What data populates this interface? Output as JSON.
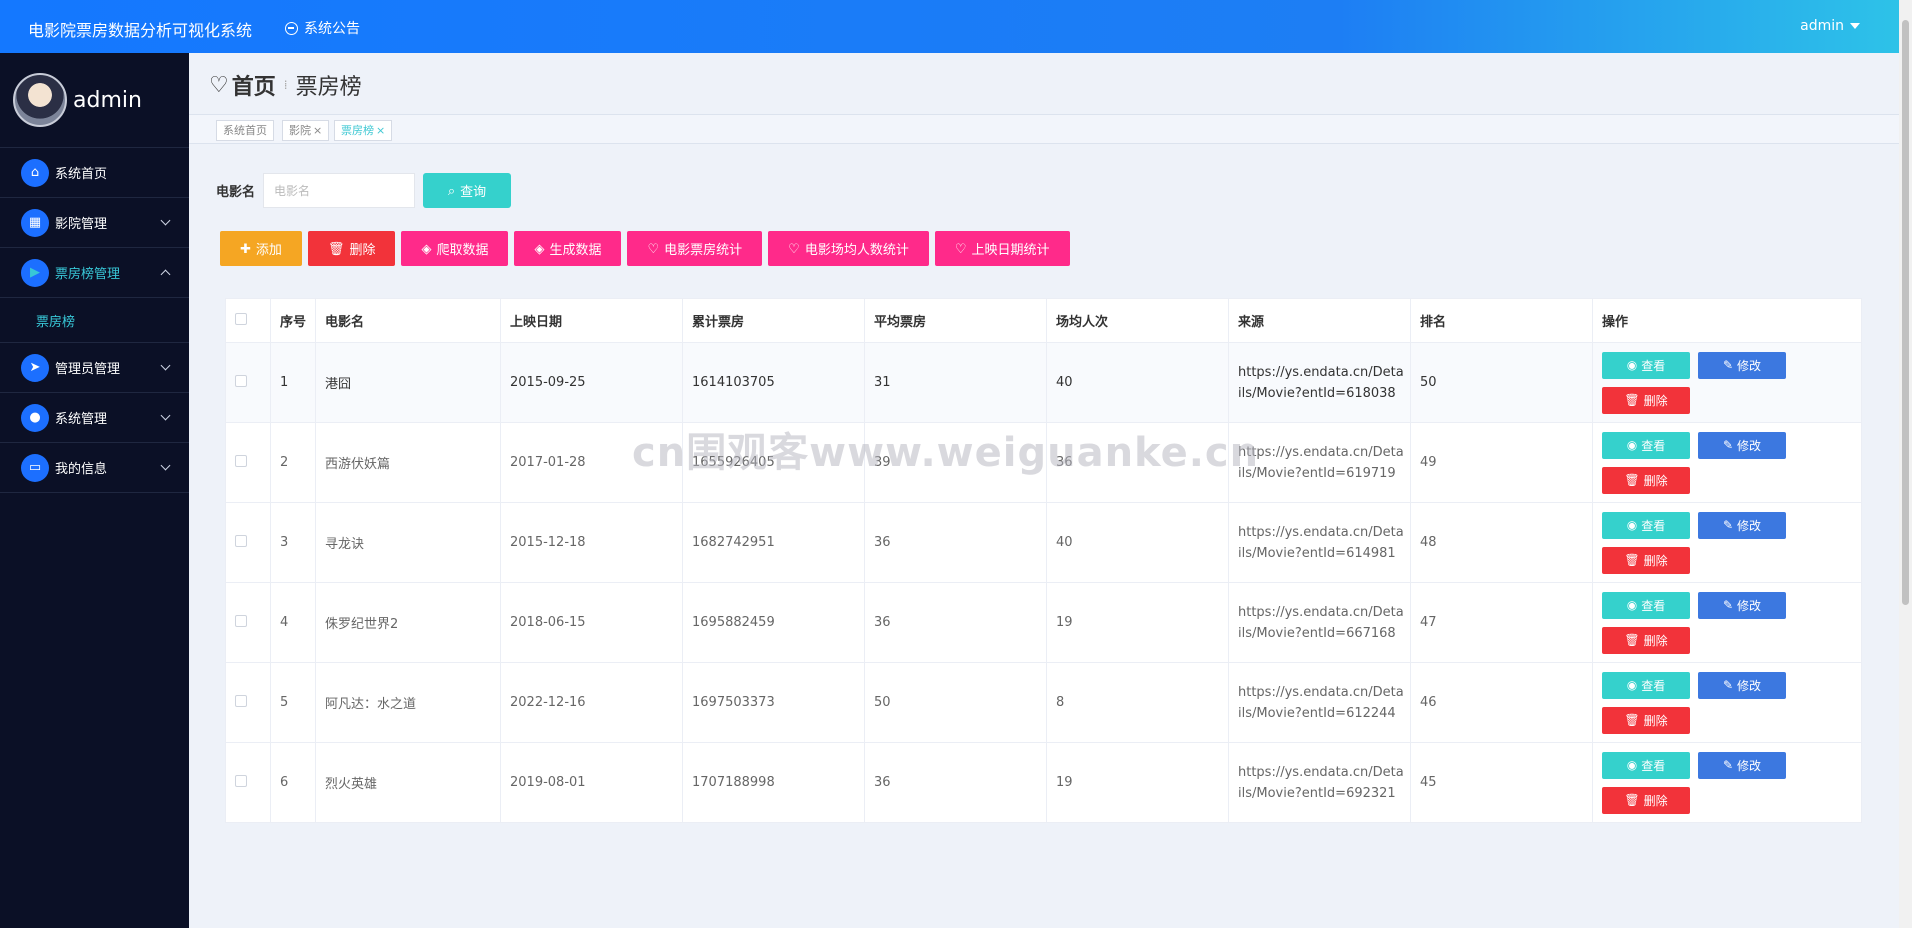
{
  "header": {
    "app_title": "电影院票房数据分析可视化系统",
    "notice_label": "系统公告",
    "user_label": "admin"
  },
  "sidebar": {
    "username": "admin",
    "items": [
      {
        "label": "系统首页",
        "icon": "home-icon"
      },
      {
        "label": "影院管理",
        "icon": "grid-icon"
      },
      {
        "label": "票房榜管理",
        "icon": "ticket-icon"
      },
      {
        "label": "管理员管理",
        "icon": "send-icon"
      },
      {
        "label": "系统管理",
        "icon": "user-icon"
      },
      {
        "label": "我的信息",
        "icon": "card-icon"
      }
    ],
    "sub_items": [
      {
        "label": "票房榜"
      }
    ]
  },
  "breadcrumb": {
    "home": "首页",
    "current": "票房榜"
  },
  "tabs": [
    {
      "label": "系统首页"
    },
    {
      "label": "影院"
    },
    {
      "label": "票房榜"
    }
  ],
  "search": {
    "label": "电影名",
    "placeholder": "电影名",
    "button": "查询"
  },
  "actions": {
    "add": "添加",
    "delete": "删除",
    "crawl": "爬取数据",
    "generate": "生成数据",
    "stat_box": "电影票房统计",
    "stat_attendance": "电影场均人数统计",
    "stat_date": "上映日期统计"
  },
  "table": {
    "headers": [
      "序号",
      "电影名",
      "上映日期",
      "累计票房",
      "平均票房",
      "场均人次",
      "来源",
      "排名",
      "操作"
    ],
    "rows": [
      {
        "no": "1",
        "name": "港囧",
        "date": "2015-09-25",
        "total": "1614103705",
        "avg": "31",
        "attendance": "40",
        "source": "https://ys.endata.cn/Details/Movie?entId=618038",
        "rank": "50"
      },
      {
        "no": "2",
        "name": "西游伏妖篇",
        "date": "2017-01-28",
        "total": "1655926405",
        "avg": "39",
        "attendance": "36",
        "source": "https://ys.endata.cn/Details/Movie?entId=619719",
        "rank": "49"
      },
      {
        "no": "3",
        "name": "寻龙诀",
        "date": "2015-12-18",
        "total": "1682742951",
        "avg": "36",
        "attendance": "40",
        "source": "https://ys.endata.cn/Details/Movie?entId=614981",
        "rank": "48"
      },
      {
        "no": "4",
        "name": "侏罗纪世界2",
        "date": "2018-06-15",
        "total": "1695882459",
        "avg": "36",
        "attendance": "19",
        "source": "https://ys.endata.cn/Details/Movie?entId=667168",
        "rank": "47"
      },
      {
        "no": "5",
        "name": "阿凡达：水之道",
        "date": "2022-12-16",
        "total": "1697503373",
        "avg": "50",
        "attendance": "8",
        "source": "https://ys.endata.cn/Details/Movie?entId=612244",
        "rank": "46"
      },
      {
        "no": "6",
        "name": "烈火英雄",
        "date": "2019-08-01",
        "total": "1707188998",
        "avg": "36",
        "attendance": "19",
        "source": "https://ys.endata.cn/Details/Movie?entId=692321",
        "rank": "45"
      }
    ],
    "row_actions": {
      "view": "查看",
      "edit": "修改",
      "delete": "删除"
    }
  },
  "watermark": "cn围观客www.weiguanke.cn",
  "colors": {
    "header": "#1478ff",
    "sidebar": "#0b1026",
    "teal": "#35d1cc",
    "blue": "#3c78e0",
    "red": "#f2333a",
    "pink": "#ff2a8a",
    "orange": "#f5a623"
  }
}
